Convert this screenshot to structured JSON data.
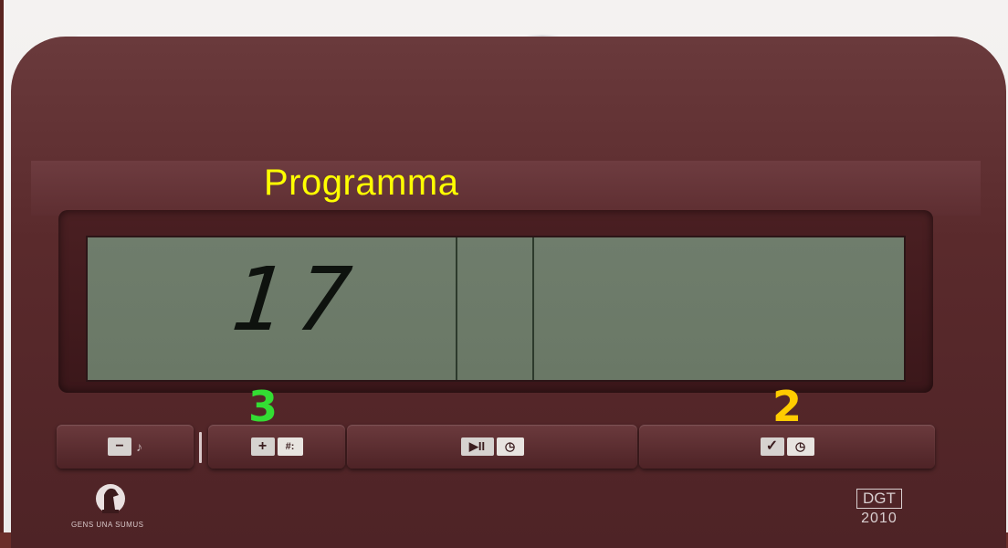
{
  "overlay": {
    "title": "Programma",
    "label_3": "3",
    "label_2": "2",
    "label_3_color": "#33dd33",
    "label_2_color": "#ffcc00",
    "title_color": "#ffff00"
  },
  "display": {
    "left_value": "17"
  },
  "buttons": {
    "minus": {
      "glyph": "−",
      "icon": "minus-icon"
    },
    "plus": {
      "glyph": "+",
      "icon": "plus-icon"
    },
    "play": {
      "glyph": "▶II",
      "icon": "play-pause-icon"
    },
    "check": {
      "glyph": "✓",
      "icon": "check-icon"
    }
  },
  "branding": {
    "logo_text": "GENS UNA SUMUS",
    "brand": "DGT",
    "year": "2010"
  }
}
